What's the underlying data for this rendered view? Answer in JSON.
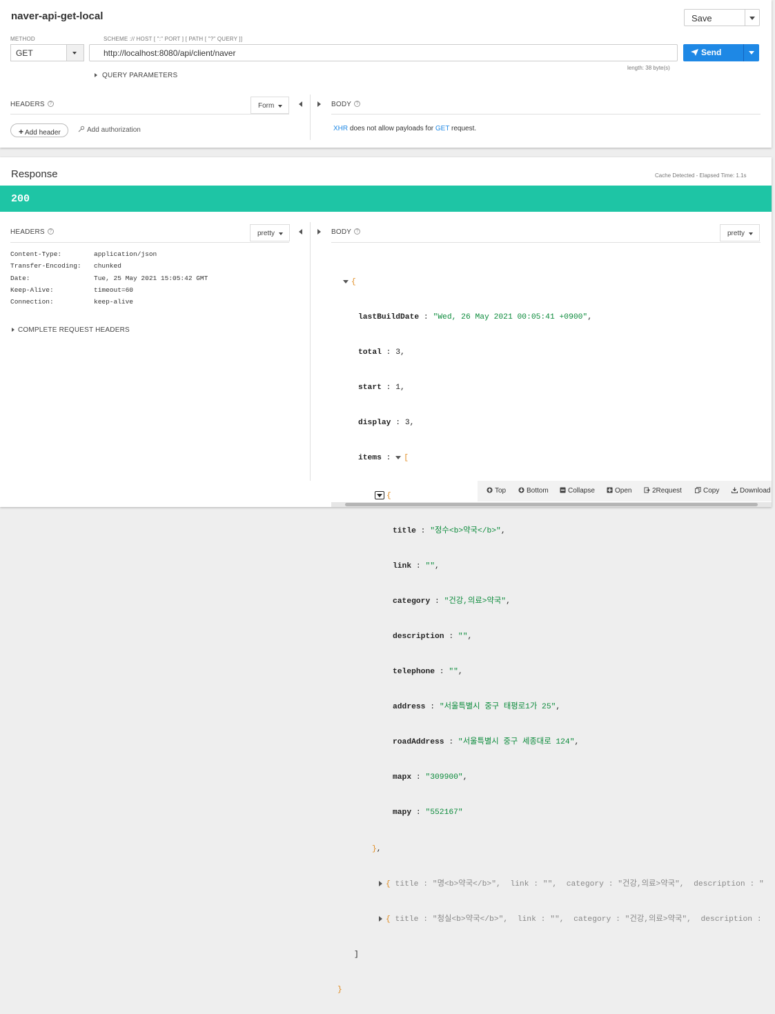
{
  "request": {
    "title": "naver-api-get-local",
    "save_label": "Save",
    "method_caption": "METHOD",
    "method": "GET",
    "url_caption": "SCHEME :// HOST [ \":\" PORT ] [ PATH [ \"?\" QUERY ]]",
    "url": "http://localhost:8080/api/client/naver",
    "send_label": "Send",
    "length": "length: 38 byte(s)",
    "query_parameters": "QUERY PARAMETERS",
    "headers_label": "HEADERS",
    "form_label": "Form",
    "body_label": "BODY",
    "add_header_label": "Add header",
    "add_authorization_label": "Add authorization",
    "body_note": {
      "xhr": "XHR",
      "middle": " does not allow payloads for ",
      "method": "GET",
      "end": " request."
    }
  },
  "response": {
    "title": "Response",
    "cache_info": "Cache Detected - Elapsed Time: 1.1s",
    "status_code": "200",
    "headers_label": "HEADERS",
    "headers_pretty": "pretty",
    "body_label": "BODY",
    "body_pretty": "pretty",
    "headers": [
      {
        "key": "Content-Type:",
        "value": "application/json"
      },
      {
        "key": "Transfer-Encoding:",
        "value": "chunked"
      },
      {
        "key": "Date:",
        "value": "Tue, 25 May 2021 15:05:42 GMT"
      },
      {
        "key": "Keep-Alive:",
        "value": "timeout=60"
      },
      {
        "key": "Connection:",
        "value": "keep-alive"
      }
    ],
    "complete_request_headers": "COMPLETE REQUEST HEADERS",
    "json": {
      "lastBuildDate": "\"Wed, 26 May 2021 00:05:41 +0900\"",
      "total": "3",
      "start": "1",
      "display": "3",
      "item0": {
        "title": "\"정수<b>약국</b>\"",
        "link": "\"\"",
        "category": "\"건강,의료>약국\"",
        "description": "\"\"",
        "telephone": "\"\"",
        "address": "\"서울특별시 중구 태평로1가 25\"",
        "roadAddress": "\"서울특별시 중구 세종대로 124\"",
        "mapx": "\"309900\"",
        "mapy": "\"552167\""
      },
      "collapsed": [
        {
          "title": "\"명<b>약국</b>\"",
          "link": "\"\"",
          "category": "\"건강,의료>약국\"",
          "description_tail": "\""
        },
        {
          "title": "\"청실<b>약국</b>\"",
          "link": "\"\"",
          "category": "\"건강,의료>약국\"",
          "description_tail": ""
        }
      ]
    },
    "toolbar": {
      "top": "Top",
      "bottom": "Bottom",
      "collapse": "Collapse",
      "open": "Open",
      "to_request": "2Request",
      "copy": "Copy",
      "download": "Download"
    }
  }
}
